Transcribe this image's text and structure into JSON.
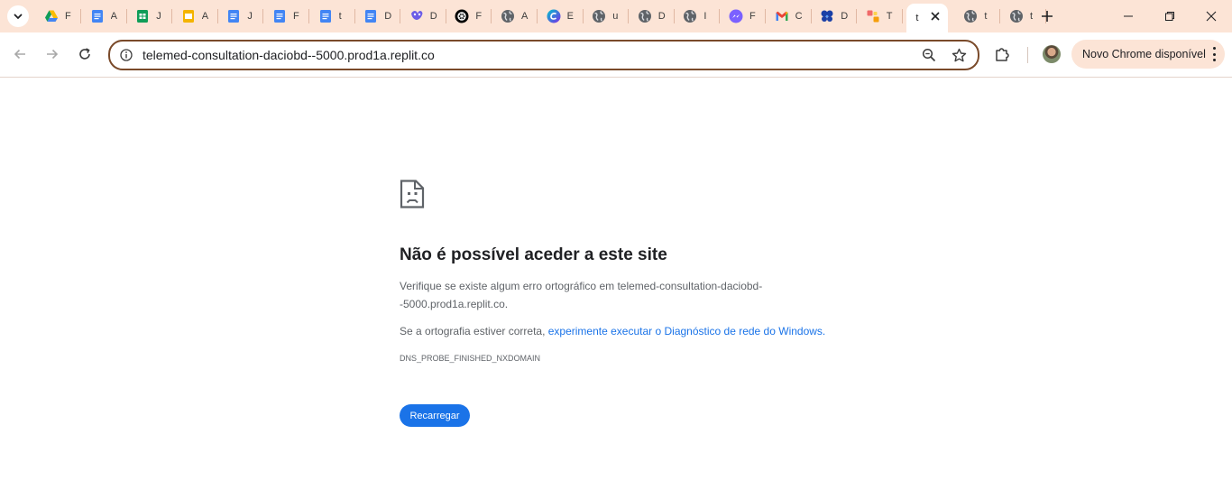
{
  "tabs": [
    {
      "label": "F",
      "icon": "google-drive-icon"
    },
    {
      "label": "A",
      "icon": "google-docs-icon"
    },
    {
      "label": "J",
      "icon": "google-sheets-icon"
    },
    {
      "label": "A",
      "icon": "google-slides-icon"
    },
    {
      "label": "J",
      "icon": "google-docs-icon"
    },
    {
      "label": "F",
      "icon": "google-docs-icon"
    },
    {
      "label": "t",
      "icon": "google-docs-icon"
    },
    {
      "label": "D",
      "icon": "google-docs-icon"
    },
    {
      "label": "D",
      "icon": "app-logo-icon"
    },
    {
      "label": "F",
      "icon": "openai-icon"
    },
    {
      "label": "A",
      "icon": "globe-icon"
    },
    {
      "label": "E",
      "icon": "canva-icon"
    },
    {
      "label": "u",
      "icon": "globe-icon"
    },
    {
      "label": "D",
      "icon": "globe-icon"
    },
    {
      "label": "I",
      "icon": "globe-icon"
    },
    {
      "label": "F",
      "icon": "messenger-icon"
    },
    {
      "label": "C",
      "icon": "gmail-icon"
    },
    {
      "label": "D",
      "icon": "butterfly-icon"
    },
    {
      "label": "T",
      "icon": "asana-icon"
    },
    {
      "label": "t",
      "icon": "none",
      "active": true
    },
    {
      "label": "t",
      "icon": "globe-icon"
    },
    {
      "label": "t",
      "icon": "globe-icon"
    }
  ],
  "omnibox": {
    "url": "telemed-consultation-daciobd--5000.prod1a.replit.co"
  },
  "update_label": "Novo Chrome disponível",
  "error": {
    "title": "Não é possível aceder a este site",
    "line1": "Verifique se existe algum erro ortográfico em telemed-consultation-daciobd--5000.prod1a.replit.co.",
    "line2_prefix": "Se a ortografia estiver correta, ",
    "line2_link": "experimente executar o Diagnóstico de rede do Windows.",
    "code": "DNS_PROBE_FINISHED_NXDOMAIN",
    "reload_label": "Recarregar"
  },
  "colors": {
    "tabstrip": "#fce4d6",
    "accent": "#1a73e8",
    "omnibox_border": "#7a4a2a"
  }
}
